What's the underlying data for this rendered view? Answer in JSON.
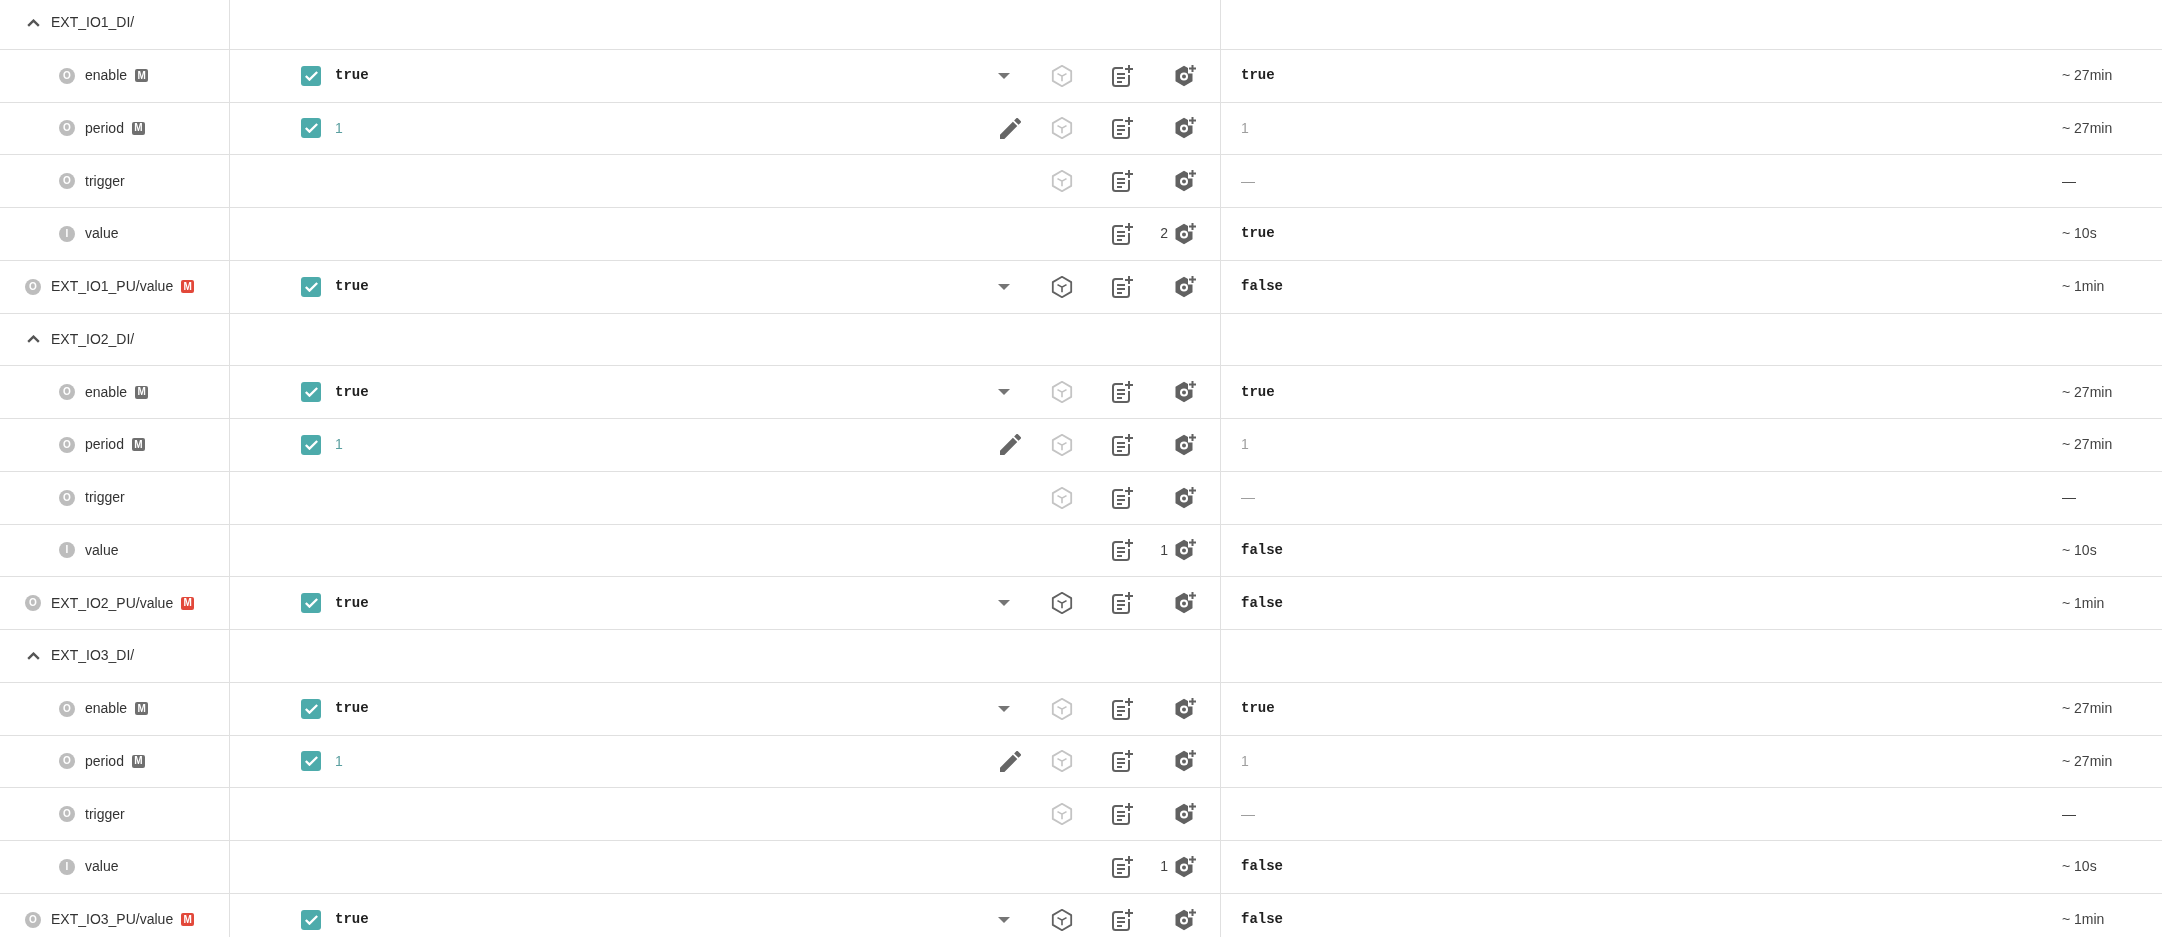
{
  "rows": [
    {
      "kind": "folder",
      "name": "EXT_IO1_DI/",
      "expanded": true,
      "children": [
        {
          "kind": "property",
          "mode": "O",
          "name": "enable",
          "badge": {
            "text": "M",
            "color": "#6f6f6f"
          },
          "setpoint": {
            "kind": "select",
            "checked": true,
            "value": "true"
          },
          "cube_active": false,
          "reported": {
            "kind": "boolean",
            "text": "true"
          },
          "age": "~ 27min"
        },
        {
          "kind": "property",
          "mode": "O",
          "name": "period",
          "badge": {
            "text": "M",
            "color": "#6f6f6f"
          },
          "setpoint": {
            "kind": "number",
            "checked": true,
            "value": "1"
          },
          "cube_active": false,
          "reported": {
            "kind": "number",
            "text": "1"
          },
          "age": "~ 27min"
        },
        {
          "kind": "property",
          "mode": "O",
          "name": "trigger",
          "cube_active": false,
          "reported": {
            "kind": "empty",
            "text": "—"
          },
          "age": "—"
        },
        {
          "kind": "property",
          "mode": "I",
          "name": "value",
          "count": "2",
          "reported": {
            "kind": "boolean",
            "text": "true"
          },
          "age": "~ 10s"
        }
      ]
    },
    {
      "kind": "property",
      "mode": "O",
      "name": "EXT_IO1_PU/value",
      "badge": {
        "text": "M",
        "color": "#e2483a"
      },
      "setpoint": {
        "kind": "select",
        "checked": true,
        "value": "true"
      },
      "cube_active": true,
      "reported": {
        "kind": "boolean",
        "text": "false"
      },
      "age": "~ 1min"
    },
    {
      "kind": "folder",
      "name": "EXT_IO2_DI/",
      "expanded": true,
      "children": [
        {
          "kind": "property",
          "mode": "O",
          "name": "enable",
          "badge": {
            "text": "M",
            "color": "#6f6f6f"
          },
          "setpoint": {
            "kind": "select",
            "checked": true,
            "value": "true"
          },
          "cube_active": false,
          "reported": {
            "kind": "boolean",
            "text": "true"
          },
          "age": "~ 27min"
        },
        {
          "kind": "property",
          "mode": "O",
          "name": "period",
          "badge": {
            "text": "M",
            "color": "#6f6f6f"
          },
          "setpoint": {
            "kind": "number",
            "checked": true,
            "value": "1"
          },
          "cube_active": false,
          "reported": {
            "kind": "number",
            "text": "1"
          },
          "age": "~ 27min"
        },
        {
          "kind": "property",
          "mode": "O",
          "name": "trigger",
          "cube_active": false,
          "reported": {
            "kind": "empty",
            "text": "—"
          },
          "age": "—"
        },
        {
          "kind": "property",
          "mode": "I",
          "name": "value",
          "count": "1",
          "reported": {
            "kind": "boolean",
            "text": "false"
          },
          "age": "~ 10s"
        }
      ]
    },
    {
      "kind": "property",
      "mode": "O",
      "name": "EXT_IO2_PU/value",
      "badge": {
        "text": "M",
        "color": "#e2483a"
      },
      "setpoint": {
        "kind": "select",
        "checked": true,
        "value": "true"
      },
      "cube_active": true,
      "reported": {
        "kind": "boolean",
        "text": "false"
      },
      "age": "~ 1min"
    },
    {
      "kind": "folder",
      "name": "EXT_IO3_DI/",
      "expanded": true,
      "children": [
        {
          "kind": "property",
          "mode": "O",
          "name": "enable",
          "badge": {
            "text": "M",
            "color": "#6f6f6f"
          },
          "setpoint": {
            "kind": "select",
            "checked": true,
            "value": "true"
          },
          "cube_active": false,
          "reported": {
            "kind": "boolean",
            "text": "true"
          },
          "age": "~ 27min"
        },
        {
          "kind": "property",
          "mode": "O",
          "name": "period",
          "badge": {
            "text": "M",
            "color": "#6f6f6f"
          },
          "setpoint": {
            "kind": "number",
            "checked": true,
            "value": "1"
          },
          "cube_active": false,
          "reported": {
            "kind": "number",
            "text": "1"
          },
          "age": "~ 27min"
        },
        {
          "kind": "property",
          "mode": "O",
          "name": "trigger",
          "cube_active": false,
          "reported": {
            "kind": "empty",
            "text": "—"
          },
          "age": "—"
        },
        {
          "kind": "property",
          "mode": "I",
          "name": "value",
          "count": "1",
          "reported": {
            "kind": "boolean",
            "text": "false"
          },
          "age": "~ 10s"
        }
      ]
    },
    {
      "kind": "property",
      "mode": "O",
      "name": "EXT_IO3_PU/value",
      "badge": {
        "text": "M",
        "color": "#e2483a"
      },
      "setpoint": {
        "kind": "select",
        "checked": true,
        "value": "true"
      },
      "cube_active": true,
      "reported": {
        "kind": "boolean",
        "text": "false"
      },
      "age": "~ 1min"
    }
  ]
}
